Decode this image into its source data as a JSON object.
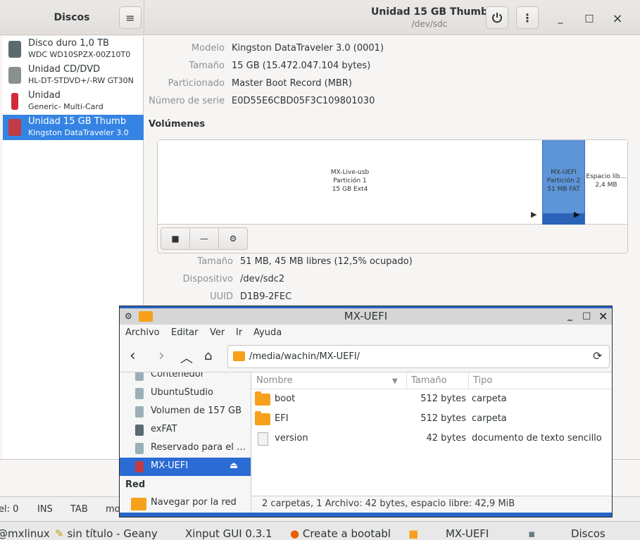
{
  "discos": {
    "app_title": "Discos",
    "menu_icon": "hamburger-menu-icon",
    "title": "Unidad 15 GB Thumb",
    "subtitle": "/dev/sdc",
    "power_icon": "power-icon",
    "more_icon": "vertical-dots-icon",
    "window_controls": {
      "minimize": "_",
      "maximize": "□",
      "close": "×"
    },
    "devices": [
      {
        "name": "Disco duro 1,0 TB",
        "model": "WDC WD10SPZX-00Z10T0",
        "icon": "hard-disk-icon"
      },
      {
        "name": "Unidad CD/DVD",
        "model": "HL-DT-STDVD+/-RW GT30N",
        "icon": "optical-drive-icon"
      },
      {
        "name": "Unidad",
        "model": "Generic- Multi-Card",
        "icon": "usb-stick-icon"
      },
      {
        "name": "Unidad 15 GB Thumb",
        "model": "Kingston DataTraveler 3.0",
        "icon": "usb-drive-icon"
      }
    ],
    "selected_device": "Unidad 15 GB Thumb",
    "drive_props": [
      {
        "label": "Modelo",
        "value": "Kingston DataTraveler 3.0 (0001)"
      },
      {
        "label": "Tamaño",
        "value": "15 GB (15.472.047.104 bytes)"
      },
      {
        "label": "Particionado",
        "value": "Master Boot Record (MBR)"
      },
      {
        "label": "Número de serie",
        "value": "E0D55E6CBD05F3C109801030"
      }
    ],
    "volumes_heading": "Volúmenes",
    "volumes": [
      {
        "name": "MX-Live-usb",
        "part": "Partición 1",
        "info": "15 GB Ext4"
      },
      {
        "name": "MX-UEFI",
        "part": "Partición 2",
        "info": "51 MB FAT"
      },
      {
        "name": "Espacio lib…",
        "part": "",
        "info": "2,4 MB"
      }
    ],
    "volume_tools": [
      "stop-icon",
      "minus-icon",
      "gears-icon"
    ],
    "volume_props": [
      {
        "label": "Tamaño",
        "value": "51 MB, 45 MB libres (12,5% ocupado)"
      },
      {
        "label": "Dispositivo",
        "value": "/dev/sdc2"
      },
      {
        "label": "UUID",
        "value": "D1B9-2FEC"
      }
    ]
  },
  "geany_status": {
    "line": "el: 0",
    "ins": "INS",
    "tab": "TAB",
    "mode": "mo"
  },
  "taskbar": [
    {
      "label": "@mxlinux",
      "icon": ""
    },
    {
      "label": "sin título - Geany",
      "icon": "geany-icon"
    },
    {
      "label": "Xinput GUI 0.3.1",
      "icon": ""
    },
    {
      "label": "Create a bootabl",
      "icon": "firefox-icon"
    },
    {
      "label": "MX-UEFI",
      "icon": "folder-icon"
    },
    {
      "label": "Discos",
      "icon": "disks-icon"
    }
  ],
  "fm": {
    "title": "MX-UEFI",
    "menu": [
      "Archivo",
      "Editar",
      "Ver",
      "Ir",
      "Ayuda"
    ],
    "path": "/media/wachin/MX-UEFI/",
    "sidebar": [
      {
        "label": "Contenedor",
        "selected": false
      },
      {
        "label": "UbuntuStudio",
        "selected": false
      },
      {
        "label": "Volumen de 157 GB",
        "selected": false
      },
      {
        "label": "exFAT",
        "selected": false
      },
      {
        "label": "Reservado para el …",
        "selected": false
      },
      {
        "label": "MX-UEFI",
        "selected": true
      }
    ],
    "network_heading": "Red",
    "network_item": "Navegar por la red",
    "columns": {
      "name": "Nombre",
      "size": "Tamaño",
      "type": "Tipo"
    },
    "files": [
      {
        "name": "boot",
        "size": "512 bytes",
        "type": "carpeta",
        "icon": "folder-icon"
      },
      {
        "name": "EFI",
        "size": "512 bytes",
        "type": "carpeta",
        "icon": "folder-icon"
      },
      {
        "name": "version",
        "size": "42 bytes",
        "type": "documento de texto sencillo",
        "icon": "text-document-icon"
      }
    ],
    "status": "2 carpetas, 1 Archivo: 42 bytes, espacio libre: 42,9  MiB"
  },
  "colors": {
    "accent": "#3584e4",
    "fm_accent": "#2865c9",
    "folder": "#f6a01b"
  }
}
